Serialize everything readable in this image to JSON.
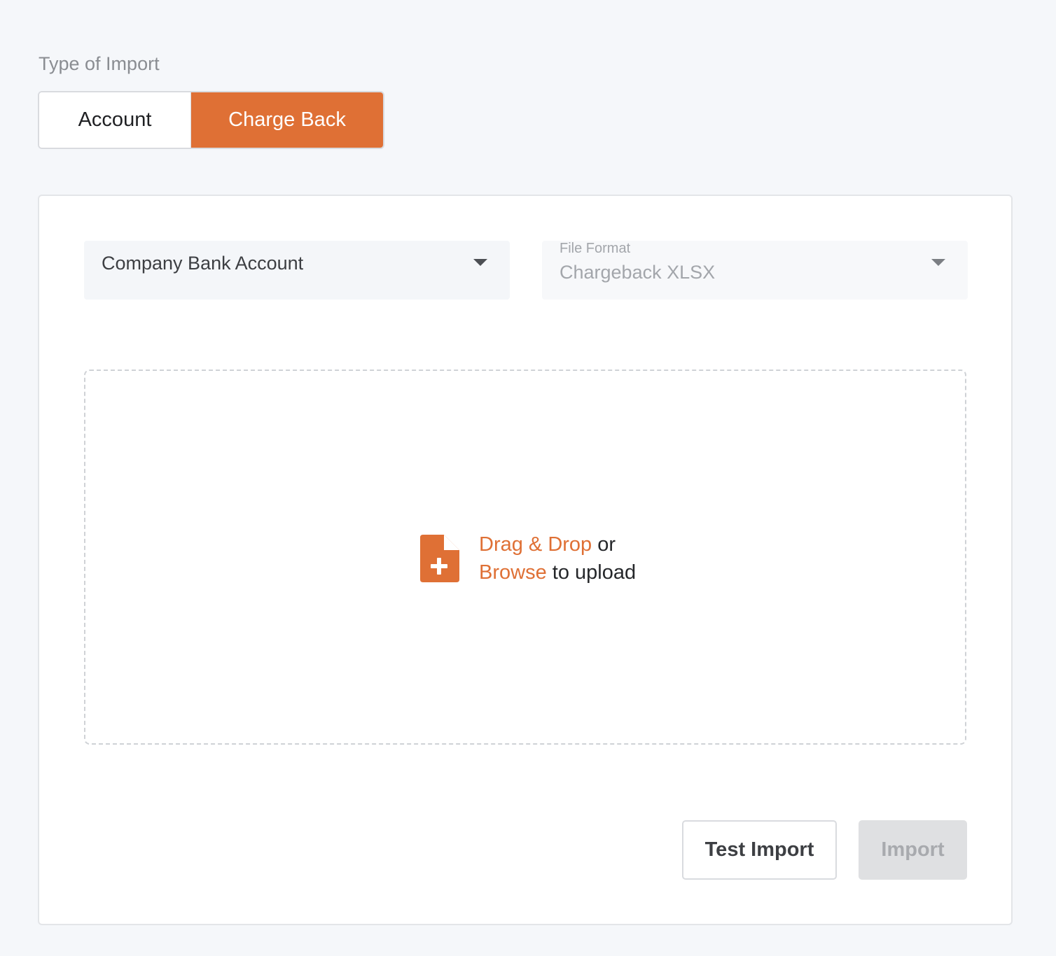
{
  "type_of_import": {
    "label": "Type of Import",
    "options": [
      "Account",
      "Charge Back"
    ],
    "selected": "Charge Back"
  },
  "bank_select": {
    "value": "Company Bank Account"
  },
  "file_format_select": {
    "label": "File Format",
    "value": "Chargeback XLSX"
  },
  "dropzone": {
    "drag_drop": "Drag & Drop",
    "or": " or",
    "browse": "Browse",
    "to_upload": " to upload",
    "icon": "file-add-icon"
  },
  "actions": {
    "test_import": "Test Import",
    "import": "Import"
  },
  "colors": {
    "accent": "#df7035",
    "disabled_bg": "#dfe0e2"
  }
}
